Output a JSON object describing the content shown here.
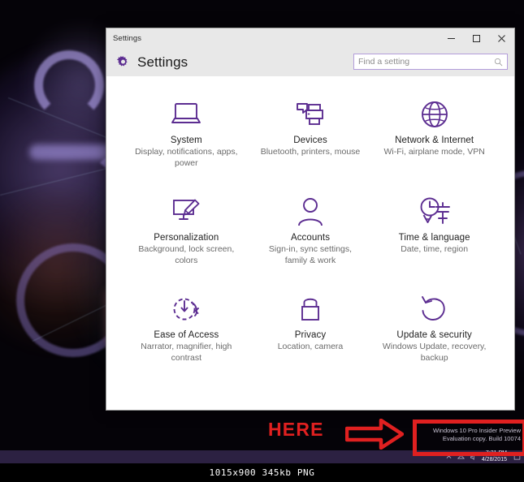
{
  "window": {
    "title": "Settings",
    "app_title": "Settings",
    "gear_icon": "gear-icon",
    "caption": {
      "minimize": "minimize-icon",
      "maximize": "maximize-icon",
      "close": "close-icon"
    },
    "search": {
      "placeholder": "Find a setting",
      "value": "",
      "icon": "search-icon"
    }
  },
  "tiles": [
    {
      "title": "System",
      "desc": "Display, notifications, apps, power",
      "icon": "monitor-icon"
    },
    {
      "title": "Devices",
      "desc": "Bluetooth, printers, mouse",
      "icon": "printer-icon"
    },
    {
      "title": "Network & Internet",
      "desc": "Wi-Fi, airplane mode, VPN",
      "icon": "globe-icon"
    },
    {
      "title": "Personalization",
      "desc": "Background, lock screen, colors",
      "icon": "paintbrush-screen-icon"
    },
    {
      "title": "Accounts",
      "desc": "Sign-in, sync settings, family & work",
      "icon": "person-icon"
    },
    {
      "title": "Time & language",
      "desc": "Date, time, region",
      "icon": "clock-language-icon"
    },
    {
      "title": "Ease of Access",
      "desc": "Narrator, magnifier, high contrast",
      "icon": "accessibility-clock-icon"
    },
    {
      "title": "Privacy",
      "desc": "Location, camera",
      "icon": "lock-icon"
    },
    {
      "title": "Update & security",
      "desc": "Windows Update, recovery, backup",
      "icon": "refresh-icon"
    }
  ],
  "annotation": {
    "here_label": "HERE",
    "arrow": "right-arrow-icon",
    "highlight": "highlight-rectangle",
    "color": "#e02020"
  },
  "watermark": {
    "line1": "Windows 10 Pro Insider Preview",
    "line2": "Evaluation copy. Build 10074"
  },
  "taskbar": {
    "clock_time": "7:21 PM",
    "clock_date": "4/28/2015",
    "tray_icons": [
      "chevron-up-icon",
      "network-icon",
      "volume-icon",
      "action-center-icon"
    ]
  },
  "infobar": {
    "text": "1015x900 345kb PNG"
  },
  "colors": {
    "accent_purple": "#5c2d91",
    "titlebar_gray": "#e8e8e8",
    "taskbar_purple": "#2c2142",
    "annotation_red": "#e02020"
  }
}
